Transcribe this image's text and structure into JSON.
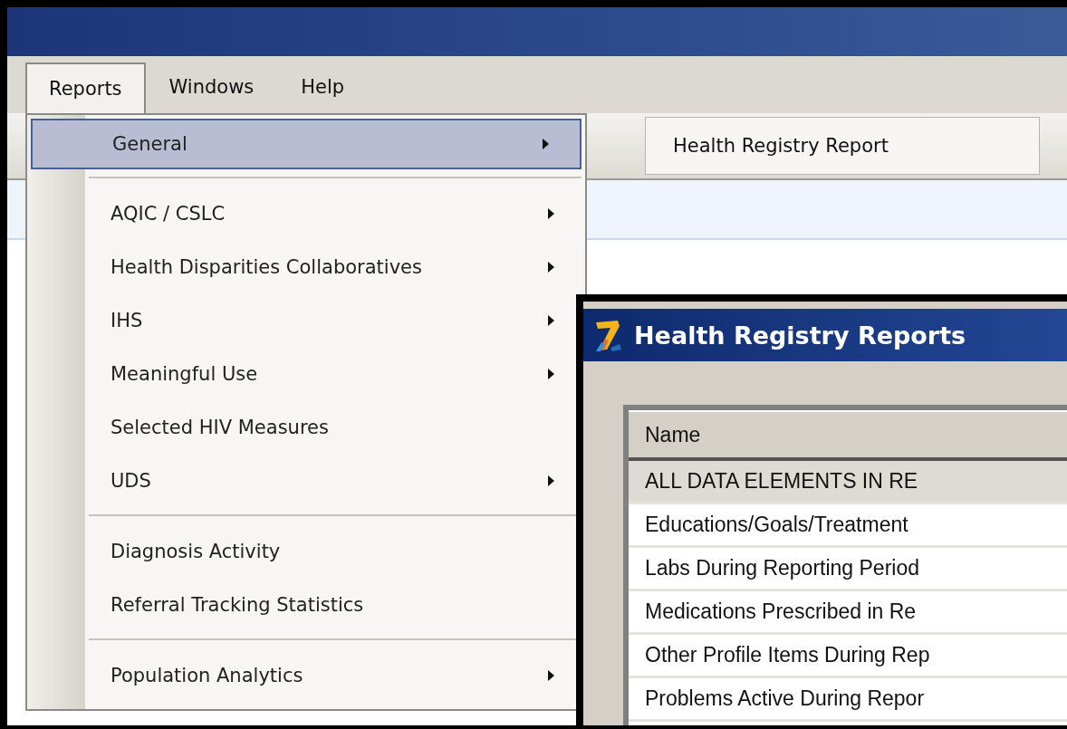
{
  "menu_bar": [
    {
      "label": "Reports",
      "selected": true
    },
    {
      "label": "Windows",
      "selected": false
    },
    {
      "label": "Help",
      "selected": false
    }
  ],
  "toolbar": {
    "tab": "Health Registry Report"
  },
  "reports_menu": [
    {
      "kind": "item",
      "label": "General",
      "submenu": true,
      "selected": true
    },
    {
      "kind": "separator"
    },
    {
      "kind": "item",
      "label": "AQIC / CSLC",
      "submenu": true,
      "selected": false
    },
    {
      "kind": "item",
      "label": "Health Disparities Collaboratives",
      "submenu": true,
      "selected": false
    },
    {
      "kind": "item",
      "label": "IHS",
      "submenu": true,
      "selected": false
    },
    {
      "kind": "item",
      "label": "Meaningful Use",
      "submenu": true,
      "selected": false
    },
    {
      "kind": "item",
      "label": "Selected HIV Measures",
      "submenu": false,
      "selected": false
    },
    {
      "kind": "item",
      "label": "UDS",
      "submenu": true,
      "selected": false
    },
    {
      "kind": "separator"
    },
    {
      "kind": "item",
      "label": "Diagnosis Activity",
      "submenu": false,
      "selected": false
    },
    {
      "kind": "item",
      "label": "Referral Tracking Statistics",
      "submenu": false,
      "selected": false
    },
    {
      "kind": "separator"
    },
    {
      "kind": "item",
      "label": "Population Analytics",
      "submenu": true,
      "selected": false
    }
  ],
  "dialog": {
    "title": "Health Registry Reports",
    "table": {
      "columns": [
        "Name"
      ],
      "rows": [
        {
          "name": "ALL DATA ELEMENTS IN RE",
          "selected": true
        },
        {
          "name": "Educations/Goals/Treatment",
          "selected": false
        },
        {
          "name": "Labs During Reporting Period",
          "selected": false
        },
        {
          "name": "Medications Prescribed in Re",
          "selected": false
        },
        {
          "name": "Other Profile Items During Rep",
          "selected": false
        },
        {
          "name": "Problems Active During Repor",
          "selected": false
        }
      ]
    }
  }
}
